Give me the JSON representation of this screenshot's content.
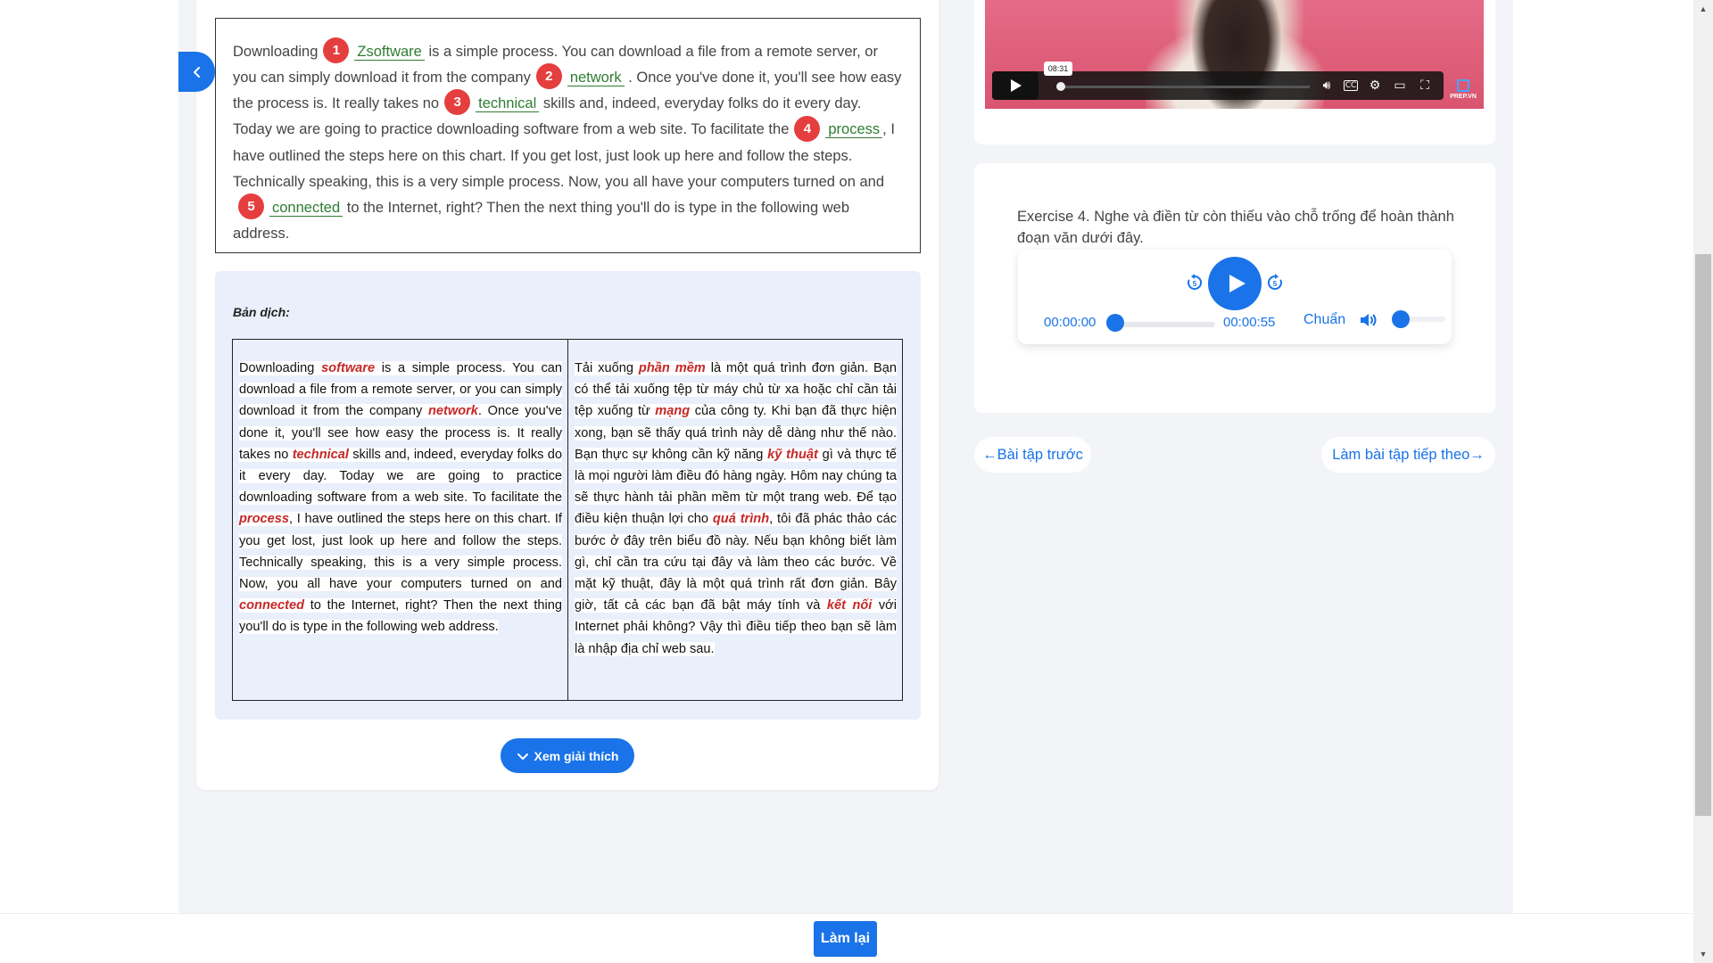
{
  "passage": {
    "fragments": [
      "Downloading",
      "is a simple process. You can download a file from a remote server, or you can simply download it from the company",
      ". Once you've done it, you'll see how easy the process is. It really takes no",
      "skills and, indeed, everyday folks do it every day. Today we are going to practice downloading software from a web site. To facilitate the",
      ", I have outlined the steps here on this chart. If you get lost, just look up here and follow the steps. Technically speaking, this is a very simple process. Now, you all have your computers turned on and",
      "to the Internet, right? Then the next thing you'll do is type in the following web address."
    ],
    "blanks": [
      {
        "number": "1",
        "answer": "Zsoftware"
      },
      {
        "number": "2",
        "answer": "network"
      },
      {
        "number": "3",
        "answer": "technical"
      },
      {
        "number": "4",
        "answer": "process"
      },
      {
        "number": "5",
        "answer": "connected"
      }
    ]
  },
  "translation": {
    "title": "Bản dịch:",
    "en": {
      "t0": "Downloading ",
      "k0": "software",
      "t1": " is a simple process. You can download a file from a remote server, or you can simply download it from the company ",
      "k1": "network",
      "t2": ". Once you've done it, you'll see how easy the process is. It really takes no ",
      "k2": "technical",
      "t3": " skills and, indeed, everyday folks do it every day. Today we are going to practice downloading software from a web site. To facilitate the ",
      "k3": "process",
      "t4": ", I have outlined the steps here on this chart. If you get lost, just look up here and follow the steps. Technically speaking, this is a very simple process. Now, you all have your computers turned on and ",
      "k4": "connected",
      "t5": " to the Internet, right? Then the next thing you'll do is type in the following web address."
    },
    "vi": {
      "t0": "Tải xuống ",
      "k0": "phần mềm",
      "t1": " là một quá trình đơn giản. Bạn có thể tải xuống tệp từ máy chủ từ xa hoặc chỉ cần tải tệp xuống từ ",
      "k1": "mạng",
      "t2": " của công ty. Khi bạn đã thực hiện xong, bạn sẽ thấy quá trình này dễ dàng như thế nào. Bạn thực sự không cần kỹ năng ",
      "k2": "kỹ thuật",
      "t3": " gì và thực tế là mọi người làm điều đó hàng ngày. Hôm nay chúng ta sẽ thực hành tải phần mềm từ một trang web. Để tạo điều kiện thuận lợi cho ",
      "k3": "quá trình",
      "t4": ", tôi đã phác thảo các bước ở đây trên biểu đồ này. Nếu bạn không biết làm gì, chỉ cần tra cứu tại đây và làm theo các bước. Về mặt kỹ thuật, đây là một quá trình rất đơn giản. Bây giờ, tất cả các bạn đã bật máy tính và ",
      "k4": "kết nối",
      "t5": " với Internet phải không? Vậy thì điều tiếp theo bạn sẽ làm là nhập địa chỉ web sau."
    }
  },
  "explain_button": "Xem giải thích",
  "video": {
    "hover_time": "08:31",
    "logo_text": "PREP.VN"
  },
  "exercise": {
    "title": "Exercise 4. Nghe và điền từ còn thiếu vào chỗ trống để hoàn thành đoạn văn dưới đây."
  },
  "audio": {
    "current_time": "00:00:00",
    "duration": "00:00:55",
    "speed": "Chuẩn",
    "progress": 0,
    "volume": 0
  },
  "nav": {
    "prev": "←Bài tập trước",
    "next": "Làm bài tập tiếp theo→"
  },
  "footer": {
    "redo": "Làm lại"
  },
  "colors": {
    "primary": "#1a73e8",
    "blank_badge": "#e53e3e",
    "answer": "#2e7d32",
    "keyword": "#c62828"
  }
}
